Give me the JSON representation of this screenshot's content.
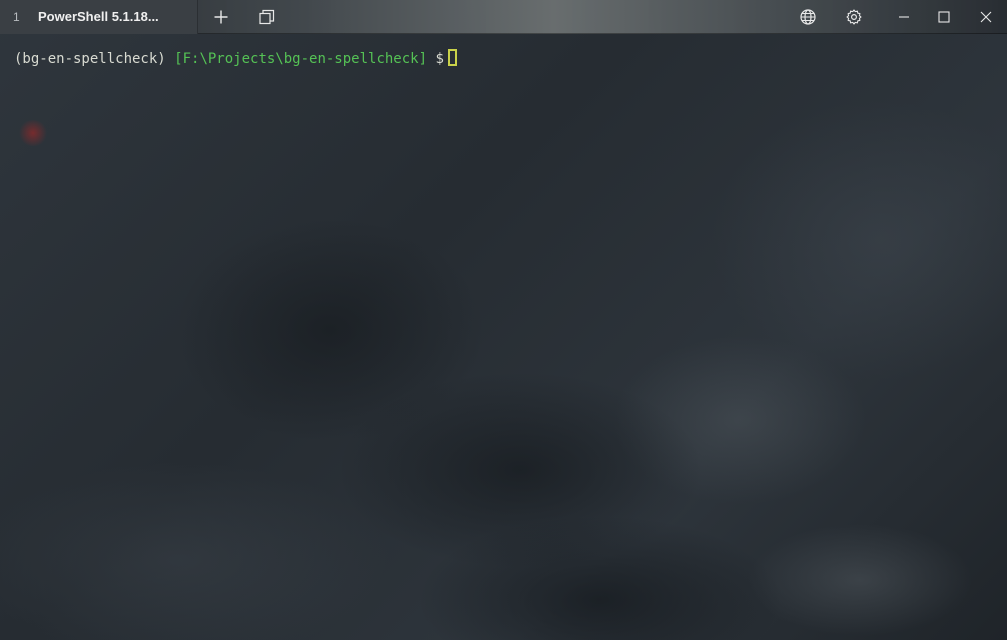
{
  "window": {
    "tab": {
      "index": "1",
      "title": "PowerShell 5.1.18..."
    },
    "buttons": {
      "new_tab_icon": "plus-icon",
      "tab_list_icon": "overlapping-windows-icon",
      "globe_icon": "globe-icon",
      "settings_icon": "gear-icon",
      "minimize_icon": "minimize-icon",
      "maximize_icon": "maximize-icon",
      "close_icon": "close-icon"
    }
  },
  "terminal": {
    "env": "(bg-en-spellcheck)",
    "path": "[F:\\Projects\\bg-en-spellcheck]",
    "symbol": "$",
    "colors": {
      "env": "#d9dbd2",
      "path": "#55c255",
      "cursor": "#c9d24a"
    }
  }
}
